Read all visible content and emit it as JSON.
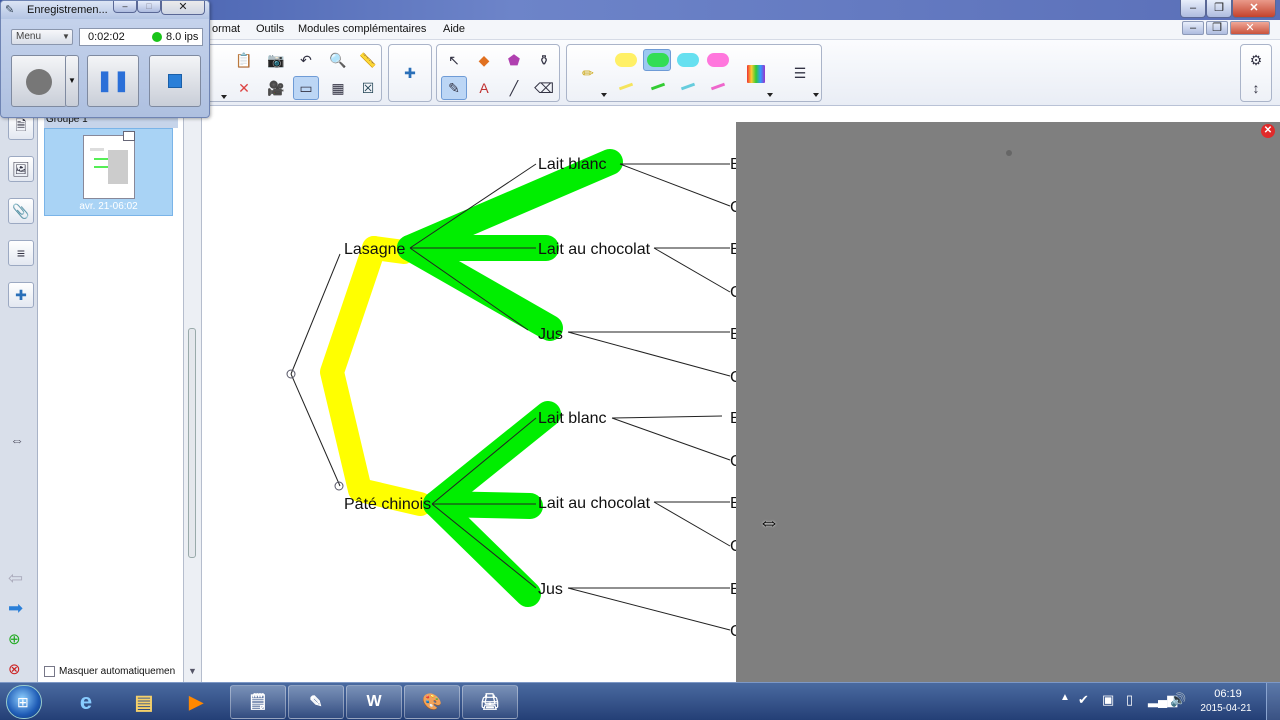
{
  "recorder": {
    "title": "Enregistremen...",
    "menu_label": "Menu",
    "time": "0:02:02",
    "fps": "8.0 ips"
  },
  "menubar": {
    "items": [
      "ormat",
      "Outils",
      "Modules complémentaires",
      "Aide"
    ]
  },
  "pages": {
    "group_label": "Groupe 1",
    "thumb_caption": "avr. 21-06:02",
    "autohide_label": "Masquer automatiquemen"
  },
  "tree": {
    "level1": [
      "Lasagne",
      "Pâté chinois"
    ],
    "level2": [
      "Lait blanc",
      "Lait au chocolat",
      "Jus",
      "Lait blanc",
      "Lait au chocolat",
      "Jus"
    ],
    "level3_partial": [
      "B",
      "C",
      "B",
      "C",
      "B",
      "C",
      "B",
      "C",
      "B",
      "C",
      "B",
      "C"
    ]
  },
  "taskbar": {
    "time": "06:19",
    "date": "2015-04-21",
    "word_label": "W"
  },
  "colors": {
    "highlight_yellow": "#ffff00",
    "highlight_green": "#00ee00",
    "shade_gray": "#7f7f7f",
    "taskbar_blue": "#2e4c86"
  }
}
